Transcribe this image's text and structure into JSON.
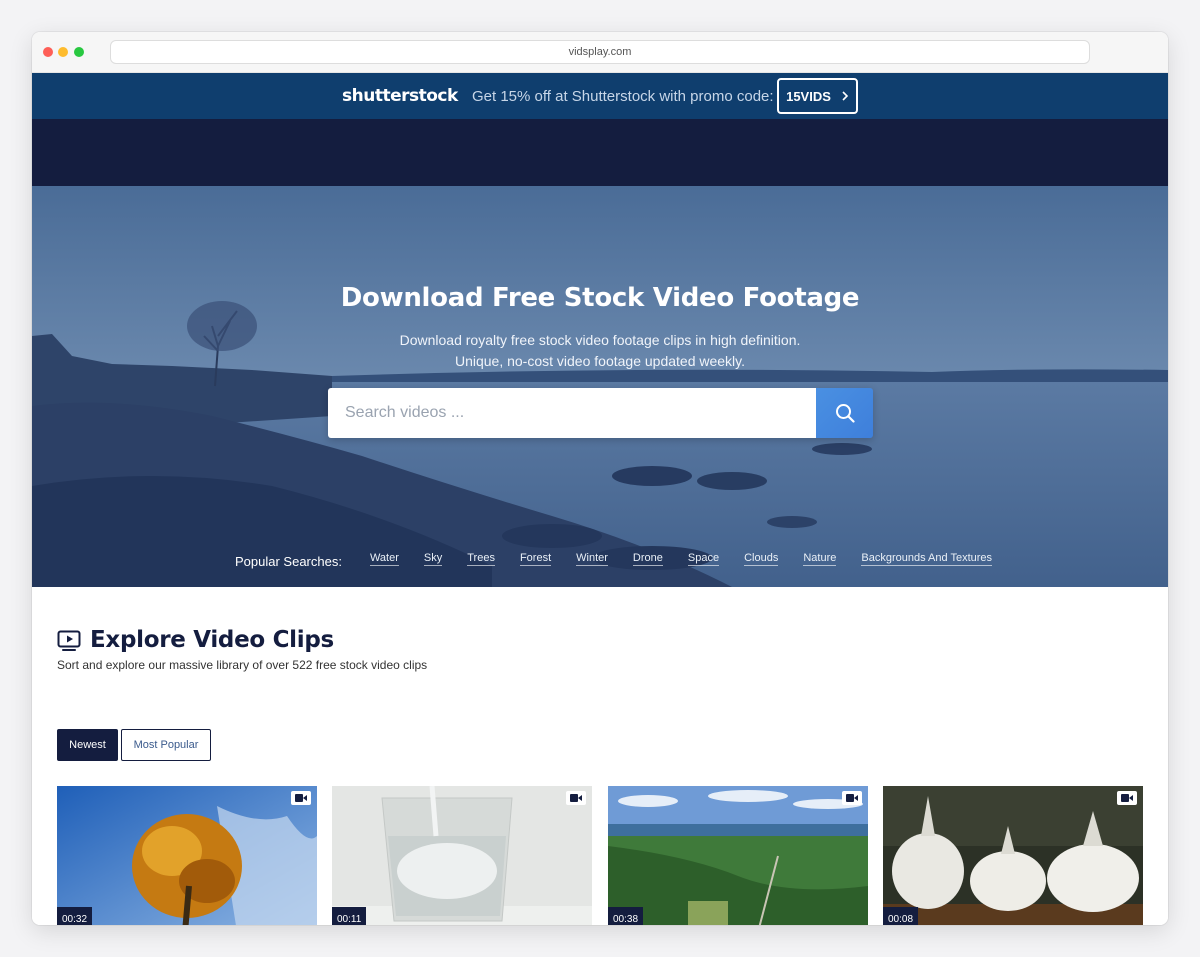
{
  "browser": {
    "url": "vidsplay.com"
  },
  "promo": {
    "logo": "shutterstock",
    "text": "Get 15% off at Shutterstock with promo code:",
    "code": "15VIDS"
  },
  "hero": {
    "title": "Download Free Stock Video Footage",
    "subtitle_line1": "Download royalty free stock video footage clips in high definition.",
    "subtitle_line2": "Unique, no-cost video footage updated weekly.",
    "search_placeholder": "Search videos ...",
    "popular_label": "Popular Searches:",
    "popular_searches": [
      "Water",
      "Sky",
      "Trees",
      "Forest",
      "Winter",
      "Drone",
      "Space",
      "Clouds",
      "Nature",
      "Backgrounds And Textures"
    ]
  },
  "explore": {
    "title": "Explore Video Clips",
    "subtitle": "Sort and explore our massive library of over 522 free stock video clips",
    "filters": [
      "Newest",
      "Most Popular"
    ],
    "videos": [
      {
        "duration": "00:32",
        "icon": "video-camera-icon"
      },
      {
        "duration": "00:11",
        "icon": "video-camera-icon"
      },
      {
        "duration": "00:38",
        "icon": "video-camera-icon"
      },
      {
        "duration": "00:08",
        "icon": "video-camera-icon"
      }
    ]
  },
  "colors": {
    "navy": "#141d3f",
    "promo_blue": "#0f3e6e",
    "accent_blue": "#4a90e2"
  }
}
